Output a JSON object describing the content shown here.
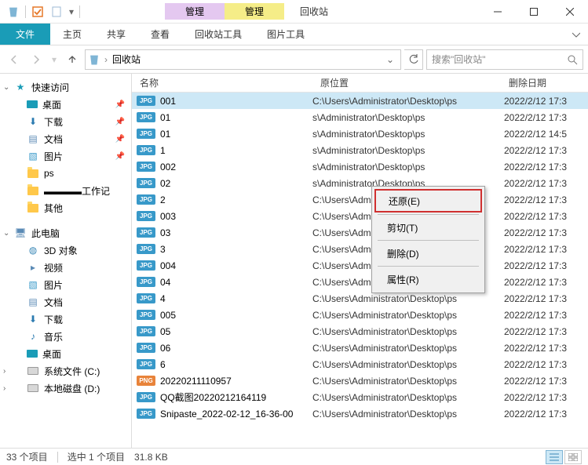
{
  "window": {
    "title": "回收站",
    "manage_label": "管理",
    "tool_tab1": "回收站工具",
    "tool_tab2": "图片工具"
  },
  "ribbon": {
    "file": "文件",
    "home": "主页",
    "share": "共享",
    "view": "查看"
  },
  "address": {
    "location": "回收站",
    "search_placeholder": "搜索\"回收站\""
  },
  "nav": {
    "quick_access": "快速访问",
    "desktop": "桌面",
    "downloads": "下载",
    "documents": "文档",
    "pictures": "图片",
    "ps": "ps",
    "workzone": "▬▬▬▬工作记",
    "other": "其他",
    "this_pc": "此电脑",
    "objects_3d": "3D 对象",
    "videos": "视频",
    "pictures2": "图片",
    "documents2": "文档",
    "downloads2": "下载",
    "music": "音乐",
    "desktop2": "桌面",
    "drive_c": "系统文件 (C:)",
    "drive_d": "本地磁盘 (D:)"
  },
  "columns": {
    "name": "名称",
    "location": "原位置",
    "date_deleted": "删除日期"
  },
  "loc_path": "C:\\Users\\Administrator\\Desktop\\ps",
  "loc_path_cut": "s\\Administrator\\Desktop\\ps",
  "files": [
    {
      "icon": "jpg",
      "name": "001",
      "date": "2022/2/12 17:3"
    },
    {
      "icon": "jpg",
      "name": "01",
      "date": "2022/2/12 17:3"
    },
    {
      "icon": "jpg",
      "name": "01",
      "date": "2022/2/12 14:5"
    },
    {
      "icon": "jpg",
      "name": "1",
      "date": "2022/2/12 17:3"
    },
    {
      "icon": "jpg",
      "name": "002",
      "date": "2022/2/12 17:3"
    },
    {
      "icon": "jpg",
      "name": "02",
      "date": "2022/2/12 17:3"
    },
    {
      "icon": "jpg",
      "name": "2",
      "date": "2022/2/12 17:3"
    },
    {
      "icon": "jpg",
      "name": "003",
      "date": "2022/2/12 17:3"
    },
    {
      "icon": "jpg",
      "name": "03",
      "date": "2022/2/12 17:3"
    },
    {
      "icon": "jpg",
      "name": "3",
      "date": "2022/2/12 17:3"
    },
    {
      "icon": "jpg",
      "name": "004",
      "date": "2022/2/12 17:3"
    },
    {
      "icon": "jpg",
      "name": "04",
      "date": "2022/2/12 17:3"
    },
    {
      "icon": "jpg",
      "name": "4",
      "date": "2022/2/12 17:3"
    },
    {
      "icon": "jpg",
      "name": "005",
      "date": "2022/2/12 17:3"
    },
    {
      "icon": "jpg",
      "name": "05",
      "date": "2022/2/12 17:3"
    },
    {
      "icon": "jpg",
      "name": "06",
      "date": "2022/2/12 17:3"
    },
    {
      "icon": "jpg",
      "name": "6",
      "date": "2022/2/12 17:3"
    },
    {
      "icon": "png",
      "name": "20220211110957",
      "date": "2022/2/12 17:3"
    },
    {
      "icon": "jpg",
      "name": "QQ截图20220212164119",
      "date": "2022/2/12 17:3"
    },
    {
      "icon": "jpg",
      "name": "Snipaste_2022-02-12_16-36-00",
      "date": "2022/2/12 17:3"
    }
  ],
  "context_menu": {
    "restore": "还原(E)",
    "cut": "剪切(T)",
    "delete": "删除(D)",
    "properties": "属性(R)"
  },
  "status": {
    "count": "33 个项目",
    "selected": "选中 1 个项目",
    "size": "31.8 KB"
  }
}
